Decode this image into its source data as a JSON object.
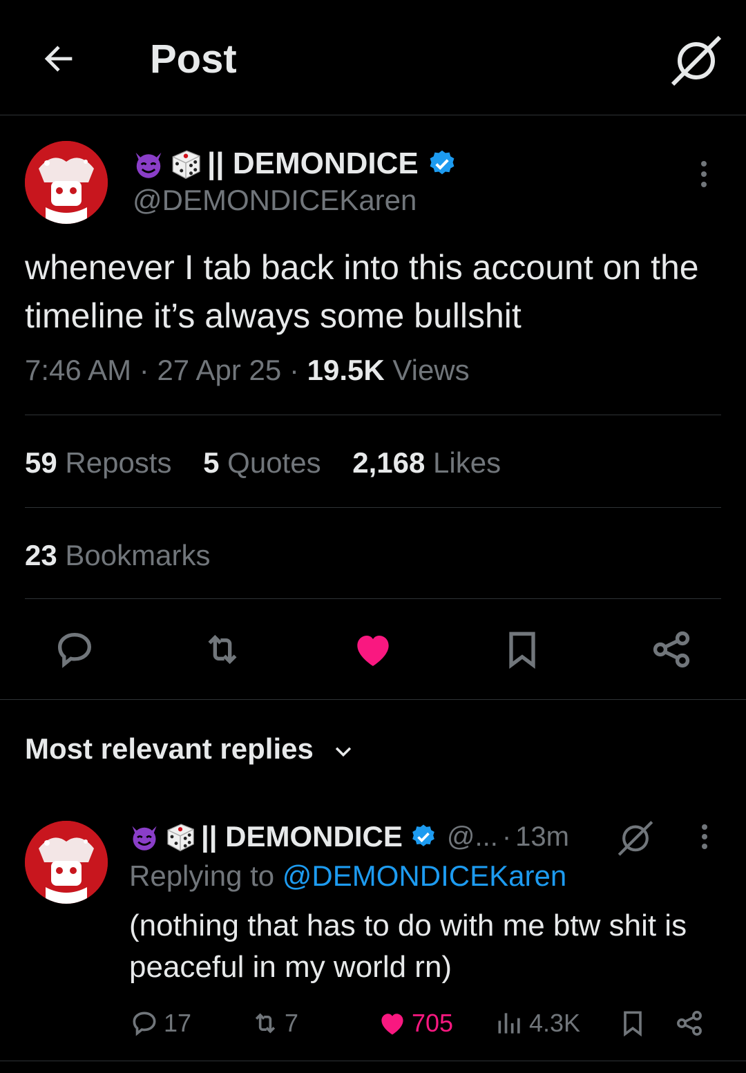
{
  "header": {
    "title": "Post"
  },
  "post": {
    "author_name": "|| DEMONDICE",
    "handle": "@DEMONDICEKaren",
    "text": "whenever I tab back into this account on the timeline it’s always some bullshit",
    "time": "7:46 AM",
    "date": "27 Apr 25",
    "views_count": "19.5K",
    "views_label": "Views",
    "sep": "·",
    "stats": {
      "reposts_count": "59",
      "reposts_label": "Reposts",
      "quotes_count": "5",
      "quotes_label": "Quotes",
      "likes_count": "2,168",
      "likes_label": "Likes",
      "bookmarks_count": "23",
      "bookmarks_label": "Bookmarks"
    },
    "liked": true,
    "like_color": "#f91880"
  },
  "replies": {
    "sort_label": "Most relevant replies",
    "items": [
      {
        "author_name": "|| DEMONDICE",
        "handle": "@...",
        "time": "13m",
        "sep": "·",
        "replying_prefix": "Replying to",
        "replying_to": "@DEMONDICEKaren",
        "text": "(nothing that has to do with me btw shit is peaceful in my world rn)",
        "counts": {
          "replies": "17",
          "reposts": "7",
          "likes": "705",
          "views": "4.3K"
        },
        "liked": true
      }
    ]
  },
  "colors": {
    "background": "#000000",
    "text": "#e7e9ea",
    "muted": "#71767b",
    "link": "#1d9bf0",
    "verified": "#1d9bf0",
    "like": "#f91880",
    "divider": "#2f3336"
  }
}
